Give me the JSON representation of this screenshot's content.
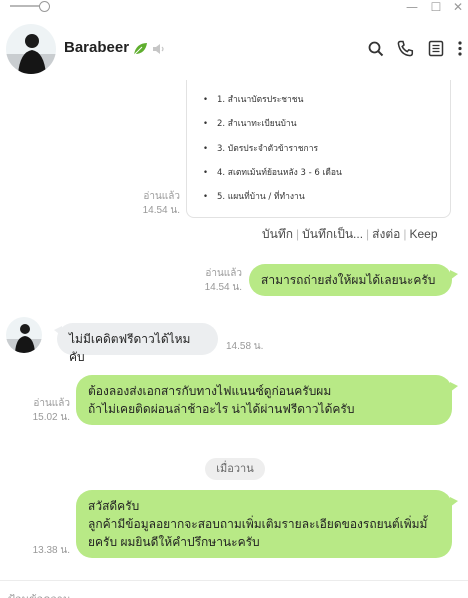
{
  "window": {
    "minimize_glyph": "—",
    "maximize_glyph": "☐",
    "close_glyph": "✕"
  },
  "header": {
    "contact_name": "Barabeer",
    "icons": [
      "leaf-icon",
      "speaker-icon",
      "search-icon",
      "phone-icon",
      "notes-icon",
      "more-icon"
    ]
  },
  "file_card": {
    "items": [
      "1. สำเนาบัตรประชาชน",
      "2. สำเนาทะเบียนบ้าน",
      "3. บัตรประจำตัวข้าราชการ",
      "4. สเตทเม้นท์ย้อนหลัง 3 - 6 เดือน",
      "5. แผนที่บ้าน / ที่ทำงาน"
    ],
    "read": "อ่านแล้ว",
    "time": "14.54 น."
  },
  "actions": {
    "save": "บันทึก",
    "save_as": "บันทึกเป็น...",
    "forward": "ส่งต่อ",
    "keep": "Keep"
  },
  "messages": [
    {
      "direction": "out",
      "text": "สามารถถ่ายส่งให้ผมได้เลยนะครับ",
      "read": "อ่านแล้ว",
      "time": "14.54 น."
    },
    {
      "direction": "in",
      "text": "ไม่มีเคดิตฟรีดาวได้ไหมคับ",
      "time": "14.58 น."
    },
    {
      "direction": "out",
      "line1": "ต้องลองส่งเอกสารกับทางไฟแนนซ์ดูก่อนครับผม",
      "line2": "ถ้าไม่เคยติดผ่อนล่าช้าอะไร น่าได้ผ่านฟรีดาวได้ครับ",
      "read": "อ่านแล้ว",
      "time": "15.02 น."
    },
    {
      "direction": "out",
      "line1": "สวัสดีครับ",
      "line2": "ลูกค้ามีข้อมูลอยากจะสอบถามเพิ่มเติมรายละเอียดของรถยนต์เพิ่มมั้",
      "line3": "ยครับ ผมยินดีให้คำปรึกษานะครับ",
      "time": "13.38 น."
    }
  ],
  "date_separator": "เมื่อวาน",
  "footer": {
    "placeholder": "ป้อนข้อความ"
  },
  "colors": {
    "outgoing_bubble": "#b8e986",
    "incoming_bubble": "#eceef0",
    "meta_text": "#999999"
  }
}
